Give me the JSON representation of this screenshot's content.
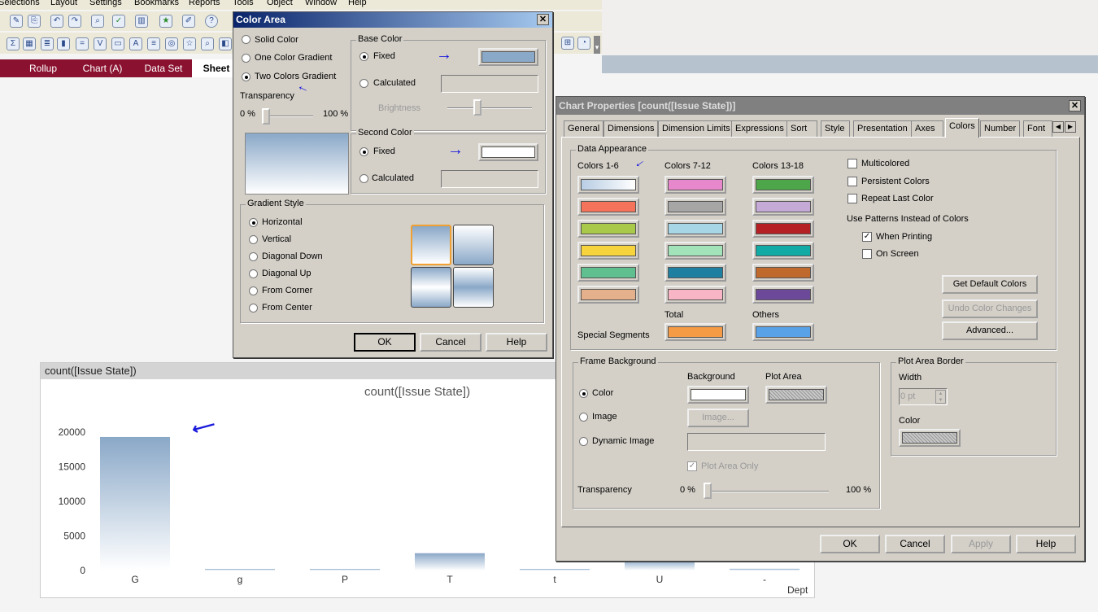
{
  "menu": [
    "Selections",
    "Layout",
    "Settings",
    "Bookmarks",
    "Reports",
    "Tools",
    "Object",
    "Window",
    "Help"
  ],
  "sheet_tabs": [
    "Rollup",
    "Chart (A)",
    "Data Set",
    "Sheet"
  ],
  "color_area": {
    "title": "Color Area",
    "modes": [
      "Solid Color",
      "One Color Gradient",
      "Two Colors Gradient"
    ],
    "selected_mode": "Two Colors Gradient",
    "transparency_label": "Transparency",
    "t_min": "0 %",
    "t_max": "100 %",
    "transparency": 0,
    "base_color": {
      "title": "Base Color",
      "fixed": "Fixed",
      "calculated": "Calculated",
      "brightness": "Brightness",
      "color": "#8aa8c8"
    },
    "second_color": {
      "title": "Second Color",
      "fixed": "Fixed",
      "calculated": "Calculated",
      "color": "#ffffff"
    },
    "gradient_style": {
      "title": "Gradient Style",
      "options": [
        "Horizontal",
        "Vertical",
        "Diagonal Down",
        "Diagonal Up",
        "From Corner",
        "From Center"
      ],
      "selected": "Horizontal"
    },
    "buttons": {
      "ok": "OK",
      "cancel": "Cancel",
      "help": "Help"
    }
  },
  "chart_props": {
    "title": "Chart Properties [count([Issue State])]",
    "tabs": [
      "General",
      "Dimensions",
      "Dimension Limits",
      "Expressions",
      "Sort",
      "Style",
      "Presentation",
      "Axes",
      "Colors",
      "Number",
      "Font"
    ],
    "active_tab": "Colors",
    "data_appearance": {
      "title": "Data Appearance",
      "col_headers": [
        "Colors 1-6",
        "Colors 7-12",
        "Colors 13-18"
      ],
      "colors": [
        [
          "#b8cde4",
          "#f4735a",
          "#a8c94a",
          "#f7d33d",
          "#5fbf8f",
          "#e5b08c"
        ],
        [
          "#e888cc",
          "#a6a6a6",
          "#a7d7e6",
          "#a3e3b9",
          "#1f7fa0",
          "#f8b5c5"
        ],
        [
          "#4ea64a",
          "#c5a9d6",
          "#b52024",
          "#12aaa5",
          "#c0692c",
          "#6d4a99"
        ]
      ],
      "special_segments": "Special Segments",
      "total": "Total",
      "others": "Others",
      "total_color": "#f59a45",
      "others_color": "#5aa2e8",
      "checks": {
        "multicolored": "Multicolored",
        "persistent": "Persistent Colors",
        "repeat_last": "Repeat Last Color"
      },
      "patterns_label": "Use Patterns Instead of Colors",
      "when_printing": "When Printing",
      "on_screen": "On Screen",
      "get_default": "Get Default Colors",
      "undo": "Undo Color Changes",
      "advanced": "Advanced..."
    },
    "frame_bg": {
      "title": "Frame Background",
      "background": "Background",
      "plot_area": "Plot Area",
      "color": "Color",
      "image": "Image",
      "dynamic_image": "Dynamic Image",
      "image_btn": "Image...",
      "plot_area_only": "Plot Area Only",
      "transparency": "Transparency",
      "t_min": "0 %",
      "t_max": "100 %"
    },
    "plot_border": {
      "title": "Plot Area Border",
      "width": "Width",
      "width_value": "0 pt",
      "color": "Color"
    },
    "buttons": {
      "ok": "OK",
      "cancel": "Cancel",
      "apply": "Apply",
      "help": "Help"
    }
  },
  "chart_data": {
    "type": "bar",
    "caption": "count([Issue State])",
    "title": "count([Issue State])",
    "xlabel": "Dept",
    "categories": [
      "G",
      "g",
      "P",
      "T",
      "t",
      "U",
      "-"
    ],
    "values": [
      19300,
      60,
      60,
      2500,
      60,
      1500,
      250
    ],
    "ylim": [
      0,
      20000
    ],
    "yticks": [
      "0",
      "5000",
      "10000",
      "15000",
      "20000"
    ],
    "bar_gradient": [
      "#8aa8c8",
      "#ffffff"
    ]
  }
}
